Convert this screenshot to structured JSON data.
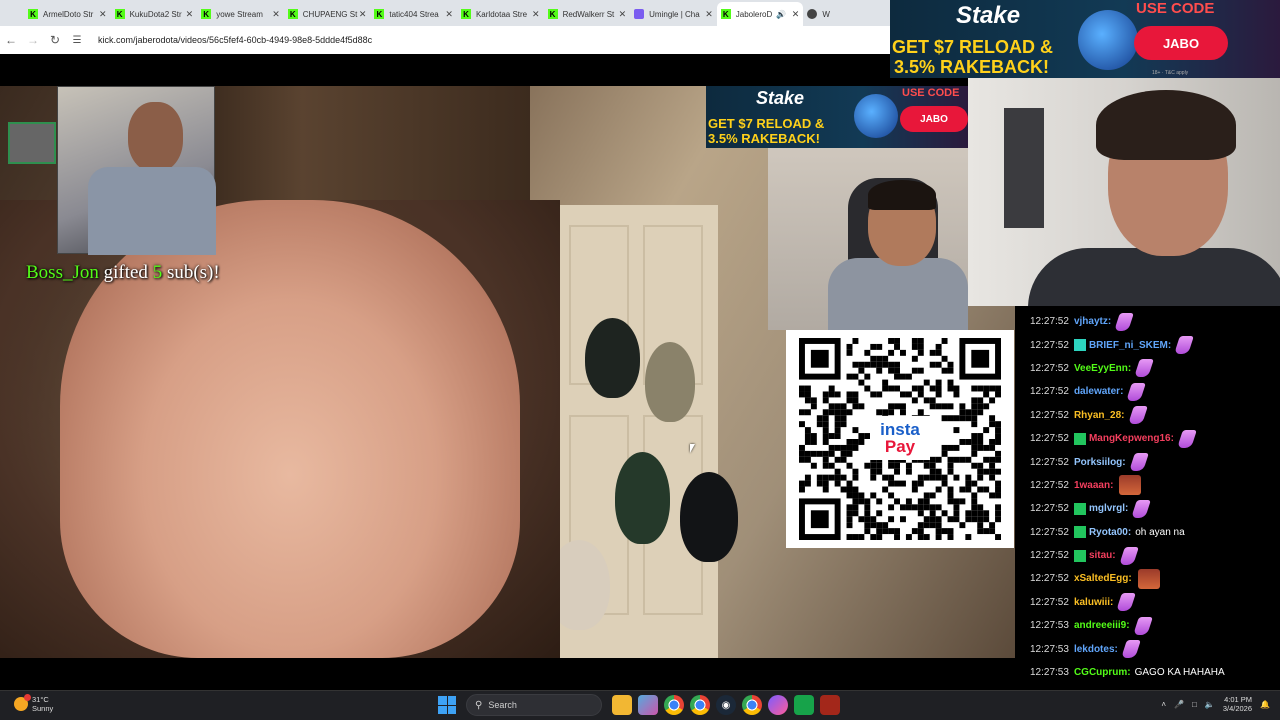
{
  "browser": {
    "tabs": [
      {
        "label": "ArmelDoto Str",
        "icon": "kick"
      },
      {
        "label": "KukuDota2 Str",
        "icon": "kick"
      },
      {
        "label": "yowe Stream",
        "icon": "kick"
      },
      {
        "label": "CHUPAENG St",
        "icon": "kick"
      },
      {
        "label": "tatic404 Strea",
        "icon": "kick"
      },
      {
        "label": "Karldotaa Stre",
        "icon": "kick"
      },
      {
        "label": "RedWalkerr St",
        "icon": "kick"
      },
      {
        "label": "Umingle | Cha",
        "icon": "umingle"
      },
      {
        "label": "JaboleroD",
        "icon": "kick",
        "active": true
      },
      {
        "label": "W",
        "icon": "globe"
      }
    ],
    "url": "kick.com/jaberodota/videos/56c5fef4-60cb-4949-98e8-5ddde4f5d88c"
  },
  "stream": {
    "gift_user": "Boss_Jon",
    "gift_word": "gifted",
    "gift_count": "5",
    "gift_suffix": "sub(s)!"
  },
  "ads": {
    "brand": "Stake",
    "headline_1": "GET $7 RELOAD &",
    "headline_2": "3.5% RAKEBACK!",
    "use_code": "USE CODE",
    "code": "JABO",
    "fineprint": "18+ · T&C apply"
  },
  "qr": {
    "logo_line_1": "insta",
    "logo_line_2": "Pay"
  },
  "chat": {
    "messages": [
      {
        "time": "12:27:52",
        "user": "vjhaytz:",
        "color": "#60a5fa",
        "badge": "",
        "text": "",
        "emote": "pink"
      },
      {
        "time": "12:27:52",
        "user": "BRIEF_ni_SKEM:",
        "color": "#60a5fa",
        "badge": "teal",
        "text": "",
        "emote": "pink"
      },
      {
        "time": "12:27:52",
        "user": "VeeEyyEnn:",
        "color": "#53fc18",
        "badge": "",
        "text": "",
        "emote": "pink"
      },
      {
        "time": "12:27:52",
        "user": "dalewater:",
        "color": "#60a5fa",
        "badge": "",
        "text": "",
        "emote": "pink"
      },
      {
        "time": "12:27:52",
        "user": "Rhyan_28:",
        "color": "#fbbf24",
        "badge": "",
        "text": "",
        "emote": "pink"
      },
      {
        "time": "12:27:52",
        "user": "MangKepweng16:",
        "color": "#f43f5e",
        "badge": "green",
        "text": "",
        "emote": "pink"
      },
      {
        "time": "12:27:52",
        "user": "Porksiilog:",
        "color": "#93c5fd",
        "badge": "",
        "text": "",
        "emote": "pink"
      },
      {
        "time": "12:27:52",
        "user": "1waaan:",
        "color": "#f43f5e",
        "badge": "",
        "text": "",
        "emote": "face"
      },
      {
        "time": "12:27:52",
        "user": "mglvrgl:",
        "color": "#93c5fd",
        "badge": "green",
        "text": "",
        "emote": "pink"
      },
      {
        "time": "12:27:52",
        "user": "Ryota00:",
        "color": "#93c5fd",
        "badge": "green",
        "text": "oh ayan na",
        "emote": ""
      },
      {
        "time": "12:27:52",
        "user": "sitau:",
        "color": "#f43f5e",
        "badge": "green",
        "text": "",
        "emote": "pink"
      },
      {
        "time": "12:27:52",
        "user": "xSaltedEgg:",
        "color": "#fbbf24",
        "badge": "",
        "text": "",
        "emote": "face"
      },
      {
        "time": "12:27:52",
        "user": "kaluwiii:",
        "color": "#fbbf24",
        "badge": "",
        "text": "",
        "emote": "pink"
      },
      {
        "time": "12:27:53",
        "user": "andreeeiii9:",
        "color": "#53fc18",
        "badge": "",
        "text": "",
        "emote": "pink"
      },
      {
        "time": "12:27:53",
        "user": "lekdotes:",
        "color": "#60a5fa",
        "badge": "",
        "text": "",
        "emote": "pink"
      },
      {
        "time": "12:27:53",
        "user": "CGCuprum:",
        "color": "#53fc18",
        "badge": "",
        "text": "GAGO KA HAHAHA",
        "emote": ""
      }
    ]
  },
  "taskbar": {
    "temp": "31°C",
    "condition": "Sunny",
    "search_placeholder": "Search",
    "time": "4:01 PM",
    "date": "3/4/2026"
  }
}
